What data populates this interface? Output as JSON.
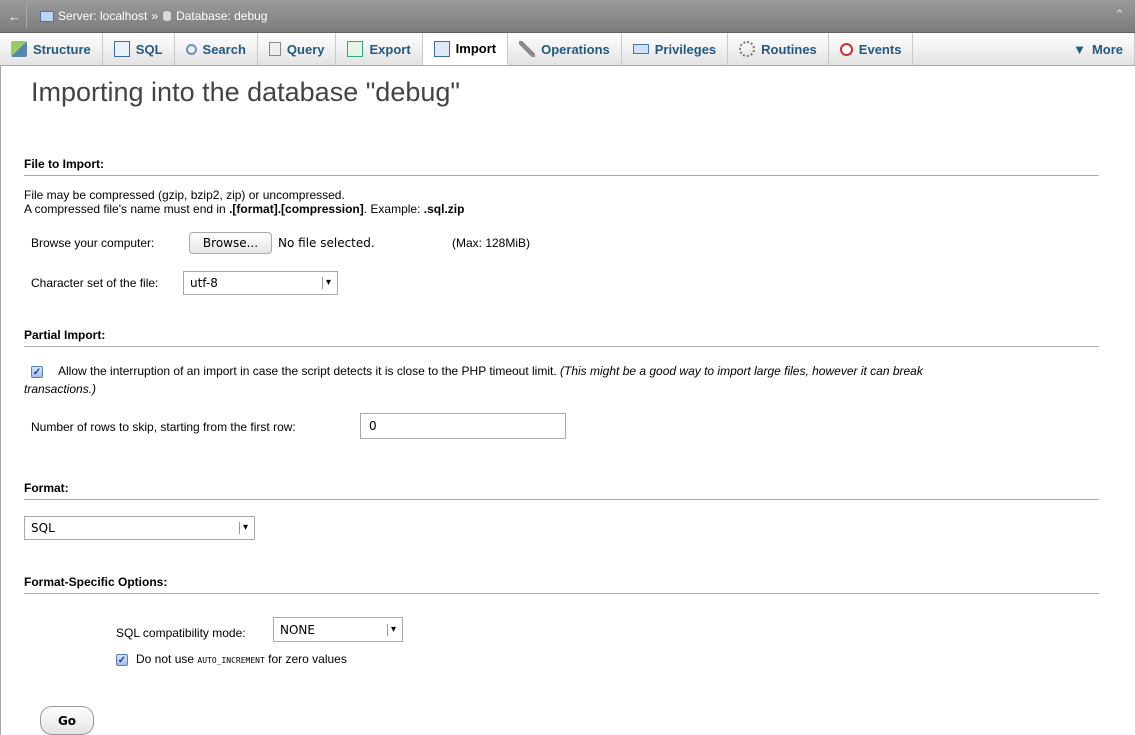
{
  "topbar": {
    "back": "←",
    "server": "Server: localhost",
    "arrow": "»",
    "database": "Database: debug",
    "collapse": "⌃"
  },
  "tabs": [
    {
      "label": "Structure",
      "icon": "structure-icon"
    },
    {
      "label": "SQL",
      "icon": "sql-icon"
    },
    {
      "label": "Search",
      "icon": "search-icon"
    },
    {
      "label": "Query",
      "icon": "query-icon"
    },
    {
      "label": "Export",
      "icon": "export-icon"
    },
    {
      "label": "Import",
      "icon": "import-icon",
      "active": true
    },
    {
      "label": "Operations",
      "icon": "operations-icon"
    },
    {
      "label": "Privileges",
      "icon": "privileges-icon"
    },
    {
      "label": "Routines",
      "icon": "routines-icon"
    },
    {
      "label": "Events",
      "icon": "events-icon"
    },
    {
      "label": "More",
      "icon": "triangle-down-icon"
    }
  ],
  "page_title": "Importing into the database \"debug\"",
  "file_import": {
    "heading": "File to Import:",
    "line1": "File may be compressed (gzip, bzip2, zip) or uncompressed.",
    "line2_prefix": "A compressed file's name must end in ",
    "line2_bold": ".[format].[compression]",
    "line2_mid": ". Example: ",
    "line2_example": ".sql.zip",
    "browse_label": "Browse your computer:",
    "browse_button": "Browse...",
    "no_file": "No file selected.",
    "max_size": "(Max: 128MiB)",
    "charset_label": "Character set of the file:",
    "charset_value": "utf-8"
  },
  "partial_import": {
    "heading": "Partial Import:",
    "allow_text": "Allow the interruption of an import in case the script detects it is close to the PHP timeout limit.",
    "allow_note_1": "(This might be a good way to import large files, however it can break",
    "allow_note_2": "transactions.)",
    "allow_checked": true,
    "skip_label": "Number of rows to skip, starting from the first row:",
    "skip_value": "0"
  },
  "format": {
    "heading": "Format:",
    "value": "SQL"
  },
  "format_options": {
    "heading": "Format-Specific Options:",
    "compat_label": "SQL compatibility mode:",
    "compat_value": "NONE",
    "auto_inc_prefix": "Do not use ",
    "auto_inc_code": "AUTO_INCREMENT",
    "auto_inc_suffix": " for zero values",
    "auto_inc_checked": true
  },
  "go_button": "Go",
  "colors": {
    "tab_text": "#235a81",
    "topbar": "#8a8a8a"
  }
}
